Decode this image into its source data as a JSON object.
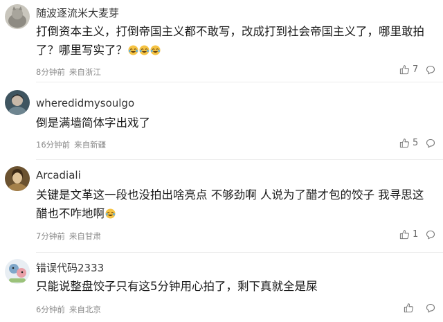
{
  "comments": [
    {
      "username": "随波逐流米大麦芽",
      "text": "打倒资本主义，打倒帝国主义都不敢写，改成打到社会帝国主义了，哪里敢拍了？哪里写实了？",
      "emoji_count": 3,
      "time": "8分钟前",
      "location": "来自浙江",
      "likes": "7",
      "avatar_icon": "avatar-cat",
      "avatar_color": "#9fa39a"
    },
    {
      "username": "wheredidmysoulgo",
      "text": "倒是满墙简体字出戏了",
      "emoji_count": 0,
      "time": "16分钟前",
      "location": "来自新疆",
      "likes": "5",
      "avatar_icon": "avatar-portrait",
      "avatar_color": "#5b6e78"
    },
    {
      "username": "Arcadiali",
      "text": "关键是文革这一段也没拍出啥亮点 不够劲啊 人说为了醋才包的饺子 我寻思这醋也不咋地啊",
      "emoji_count": 1,
      "time": "7分钟前",
      "location": "来自甘肃",
      "likes": "1",
      "avatar_icon": "avatar-portrait",
      "avatar_color": "#8a6b3e"
    },
    {
      "username": "错误代码2333",
      "text": "只能说整盘饺子只有这5分钟用心拍了，剩下真就全是屎",
      "emoji_count": 0,
      "time": "6分钟前",
      "location": "来自北京",
      "likes": "",
      "avatar_icon": "avatar-cartoon",
      "avatar_color": "#7fa7c9"
    }
  ],
  "icons": {
    "like": "thumbs-up-icon",
    "reply": "comment-bubble-icon",
    "emoji": "laughing-tears-emoji"
  }
}
